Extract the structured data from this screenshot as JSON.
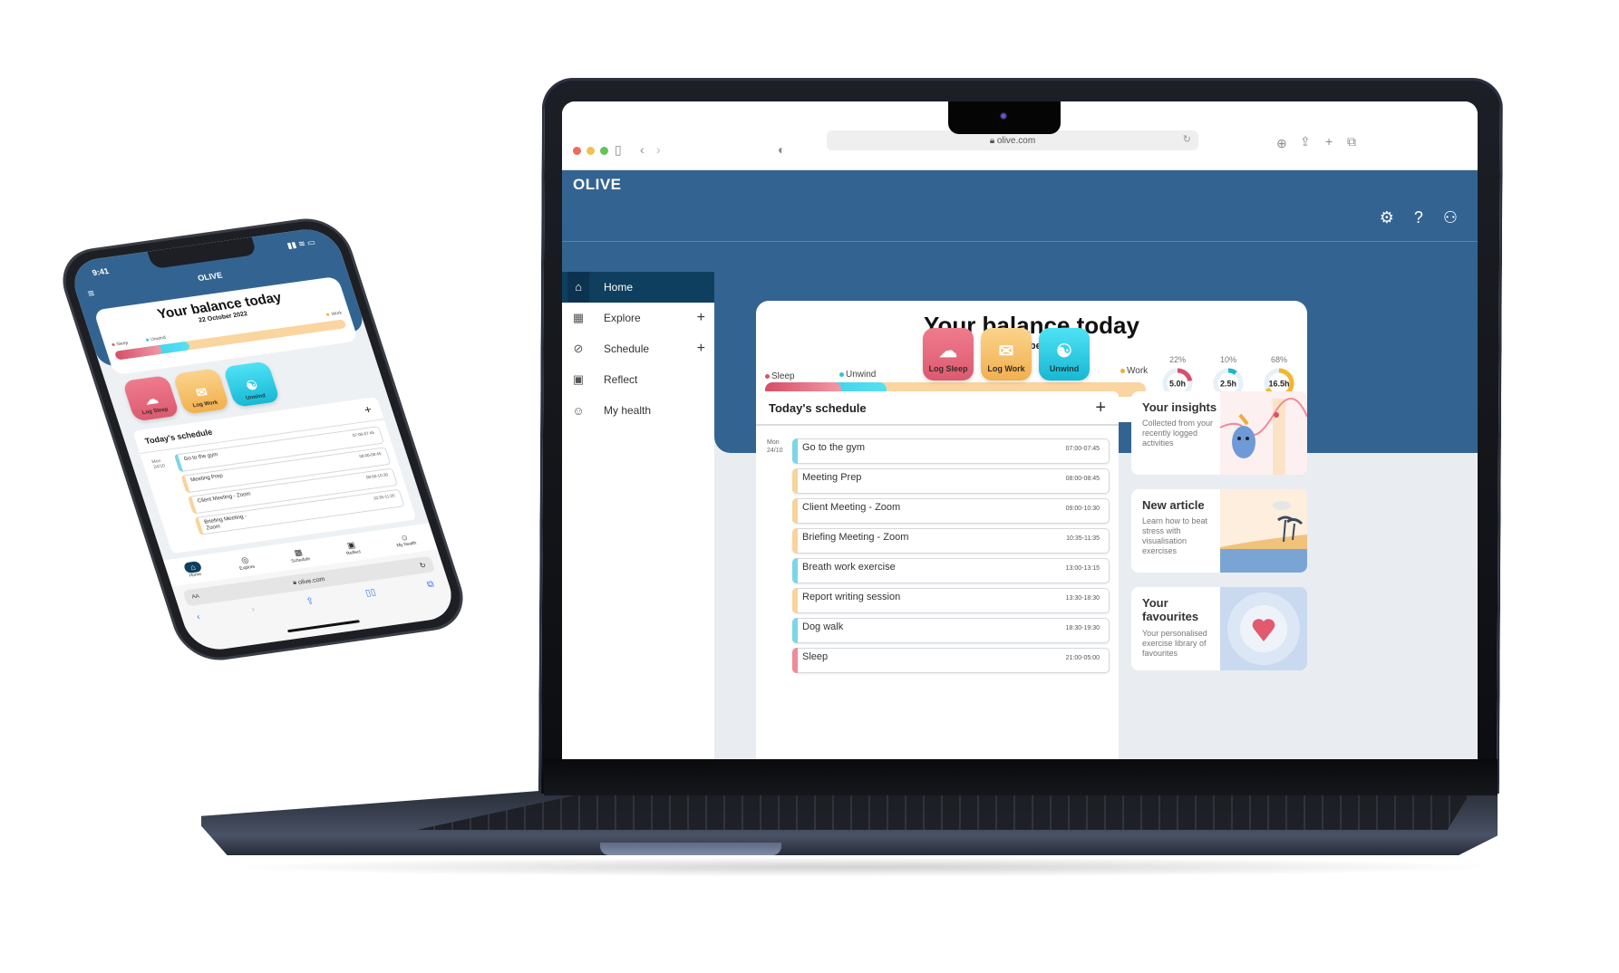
{
  "browser": {
    "url": "olive.com",
    "traffic_colors": [
      "#ed6a5e",
      "#f4bf4f",
      "#61c554"
    ]
  },
  "app": {
    "logo": "OLIVE",
    "brand_color": "#336491",
    "header_icons": [
      "settings-icon",
      "help-icon",
      "account-settings-icon"
    ]
  },
  "sidebar": {
    "items": [
      {
        "label": "Home",
        "icon": "home-icon",
        "active": true,
        "has_plus": false
      },
      {
        "label": "Explore",
        "icon": "calendar-icon",
        "active": false,
        "has_plus": true
      },
      {
        "label": "Schedule",
        "icon": "compass-icon",
        "active": false,
        "has_plus": true
      },
      {
        "label": "Reflect",
        "icon": "chart-icon",
        "active": false,
        "has_plus": false
      },
      {
        "label": "My health",
        "icon": "user-circle-icon",
        "active": false,
        "has_plus": false
      }
    ]
  },
  "balance": {
    "title": "Your balance today",
    "date": "22 October 2022",
    "legend": [
      {
        "label": "Sleep",
        "color": "#d9506a"
      },
      {
        "label": "Unwind",
        "color": "#2ec4dc"
      },
      {
        "label": "Work",
        "color": "#f2a93b"
      }
    ],
    "bar_fractions": {
      "sleep": 0.2,
      "unwind": 0.12,
      "work": 0.68
    },
    "donuts": [
      {
        "percent": "22%",
        "value": "5.0h",
        "fraction": 0.22,
        "color": "#d9506a"
      },
      {
        "percent": "10%",
        "value": "2.5h",
        "fraction": 0.1,
        "color": "#1fb5cf"
      },
      {
        "percent": "68%",
        "value": "16.5h",
        "fraction": 0.68,
        "color": "#f7b52b"
      }
    ]
  },
  "log_buttons": [
    {
      "label": "Log Sleep",
      "icon": "sheep-icon",
      "glyph": "☁",
      "color_top": "#ef7b8d",
      "color_bottom": "#dc5a70"
    },
    {
      "label": "Log Work",
      "icon": "briefcase-icon",
      "glyph": "✉",
      "color_top": "#fbd38c",
      "color_bottom": "#f1b04e"
    },
    {
      "label": "Unwind",
      "icon": "meditation-icon",
      "glyph": "☯",
      "color_top": "#4fe2f5",
      "color_bottom": "#17b8d4"
    }
  ],
  "schedule": {
    "title": "Today's schedule",
    "add_label": "+",
    "day": "Mon",
    "date": "24/10",
    "events": [
      {
        "name": "Go to the gym",
        "time": "07:00-07:45",
        "color": "#7dd6e6"
      },
      {
        "name": "Meeting Prep",
        "time": "08:00-08:45",
        "color": "#f8d49a"
      },
      {
        "name": "Client Meeting - Zoom",
        "time": "09:00-10:30",
        "color": "#f8d49a"
      },
      {
        "name": "Briefing Meeting - Zoom",
        "time": "10:35-11:35",
        "color": "#f8d49a"
      },
      {
        "name": "Breath work exercise",
        "time": "13:00-13:15",
        "color": "#7dd6e6"
      },
      {
        "name": "Report writing session",
        "time": "13:30-18:30",
        "color": "#f8d49a"
      },
      {
        "name": "Dog walk",
        "time": "18:30-19:30",
        "color": "#7dd6e6"
      },
      {
        "name": "Sleep",
        "time": "21:00-05:00",
        "color": "#f28a9a"
      }
    ]
  },
  "cards": [
    {
      "title": "Your insights",
      "desc": "Collected from your recently logged activities"
    },
    {
      "title": "New article",
      "desc": "Learn how to beat stress with visualisation exercises"
    },
    {
      "title": "Your favourites",
      "desc": "Your personalised exercise library of favourites"
    }
  ],
  "phone": {
    "time": "9:41",
    "logo": "OLIVE",
    "title": "Your balance today",
    "date": "22 October 2022",
    "legend": [
      "Sleep",
      "Unwind",
      "Work"
    ],
    "schedule_title": "Today's schedule",
    "day": "Mon",
    "date_short": "24/10",
    "events": [
      {
        "name": "Go to the gym",
        "time": "07:00-07:45",
        "color": "#7dd6e6"
      },
      {
        "name": "Meeting Prep",
        "time": "08:00-08:45",
        "color": "#f8d49a"
      },
      {
        "name": "Client Meeting - Zoom",
        "time": "09:00-10:30",
        "color": "#f8d49a"
      },
      {
        "name": "Briefing Meeting - Zoom",
        "time": "10:35-11:35",
        "color": "#f8d49a"
      }
    ],
    "tabs": [
      {
        "label": "Home",
        "glyph": "⌂",
        "active": true
      },
      {
        "label": "Explore",
        "glyph": "◎",
        "active": false
      },
      {
        "label": "Schedule",
        "glyph": "▦",
        "active": false
      },
      {
        "label": "Reflect",
        "glyph": "▣",
        "active": false
      },
      {
        "label": "My health",
        "glyph": "☺",
        "active": false
      }
    ],
    "url": "olive.com",
    "text_size_label": "AA"
  }
}
